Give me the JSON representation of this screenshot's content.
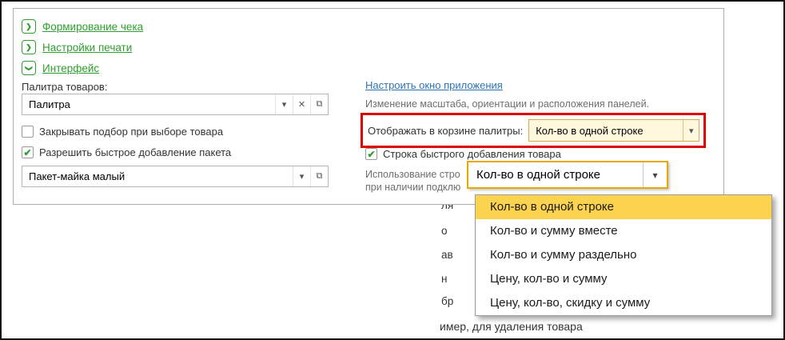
{
  "colors": {
    "section_link_green": "#2E9E2E",
    "hyperlink_blue": "#2E74B5",
    "highlight_red": "#E00000",
    "selection_yellow": "#FBD34F",
    "focused_field_border": "#E8A800",
    "highlighted_field_bg": "#FFF8DC",
    "helper_text_gray": "#6E6E6E"
  },
  "icons": {
    "chevron_collapsed": "❯",
    "chevron_expanded": "❯",
    "dropdown_arrow": "▾",
    "clear": "✕",
    "open": "⧉",
    "checkmark": "✔"
  },
  "sections": [
    {
      "label": "Формирование чека",
      "expanded": false
    },
    {
      "label": "Настройки печати",
      "expanded": false
    },
    {
      "label": "Интерфейс",
      "expanded": true
    }
  ],
  "interface_settings": {
    "palette_label": "Палитра товаров:",
    "palette_value": "Палитра",
    "close_on_select_label": "Закрывать подбор при выборе товара",
    "close_on_select_checked": false,
    "fast_package_label": "Разрешить быстрое добавление пакета",
    "fast_package_checked": true,
    "package_value": "Пакет-майка малый",
    "app_window_link": "Настроить окно приложения",
    "app_window_hint": "Изменение масштаба, ориентации и расположения панелей.",
    "basket_display_label": "Отображать в корзине палитры:",
    "basket_display_value": "Кол-во в одной строке",
    "fast_add_row_label": "Строка быстрого добавления товара",
    "fast_add_row_checked": true,
    "usage_line1": "Использование стро",
    "usage_line2": "при наличии подклю"
  },
  "dropdown_overlay": {
    "field_value": "Кол-во в одной строке",
    "selected_option": "Кол-во в одной строке",
    "options": [
      "Кол-во в одной строке",
      "Кол-во и сумму вместе",
      "Кол-во и сумму раздельно",
      "Цену, кол-во и сумму",
      "Цену, кол-во, скидку и сумму"
    ]
  },
  "background_fragments": [
    "ля",
    "о",
    "ав",
    "н",
    "бр",
    "имер,  для удаления товара"
  ]
}
